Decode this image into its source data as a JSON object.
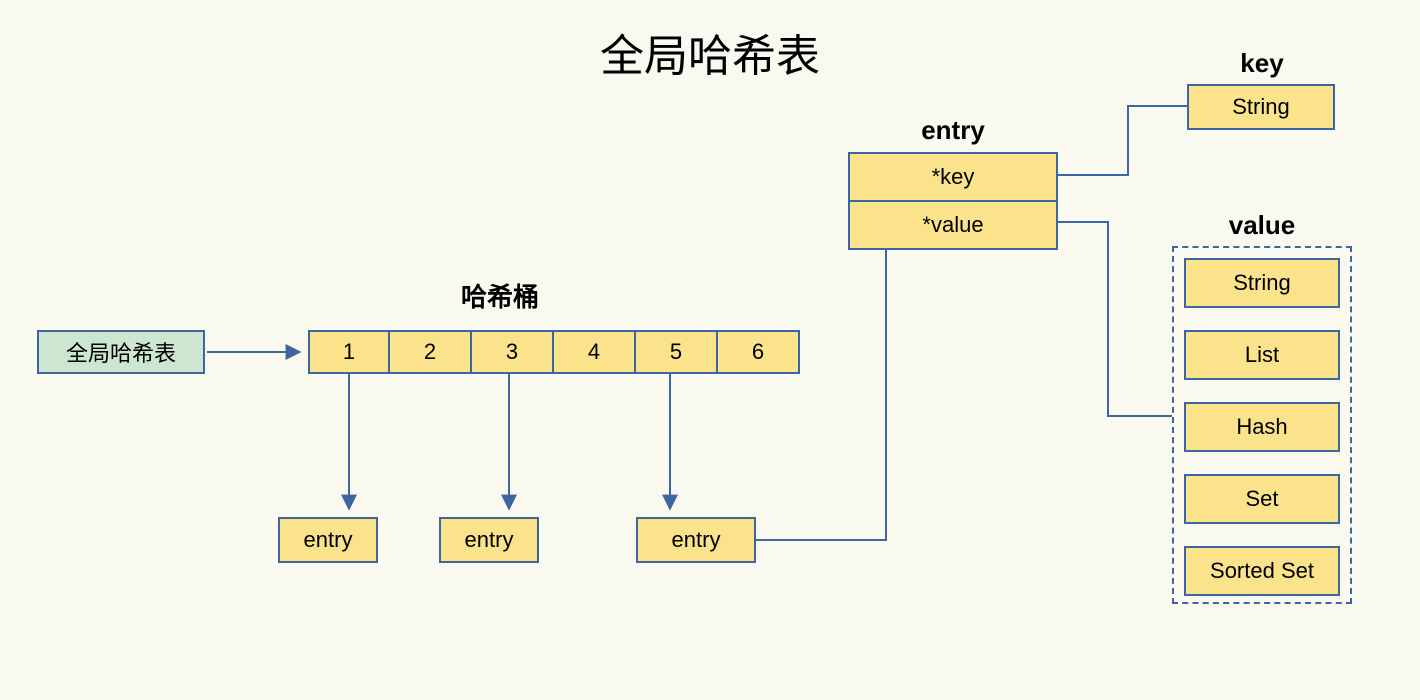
{
  "title": "全局哈希表",
  "global_hash": {
    "label": "全局哈希表"
  },
  "bucket": {
    "heading": "哈希桶",
    "items": [
      "1",
      "2",
      "3",
      "4",
      "5",
      "6"
    ]
  },
  "entry_nodes": {
    "label": "entry"
  },
  "entry_struct": {
    "heading": "entry",
    "key_field": "*key",
    "value_field": "*value"
  },
  "key_section": {
    "heading": "key",
    "type": "String"
  },
  "value_section": {
    "heading": "value",
    "types": [
      "String",
      "List",
      "Hash",
      "Set",
      "Sorted Set"
    ]
  }
}
